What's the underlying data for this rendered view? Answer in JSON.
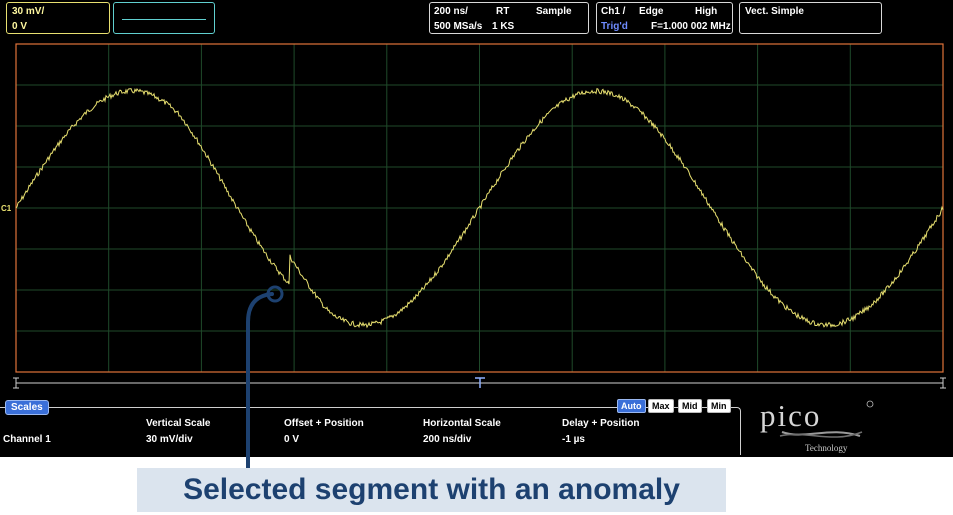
{
  "channel": {
    "scale": "30 mV/",
    "offset": "0 V",
    "color": "#e8e070"
  },
  "timebase": {
    "time_div": "200 ns/",
    "mode": "RT",
    "acq": "Sample",
    "sample_rate": "500 MSa/s",
    "record": "1 KS"
  },
  "trigger": {
    "source": "Ch1 /",
    "type": "Edge",
    "level": "High",
    "status": "Trig'd",
    "freq": "F=1.000 002 MHz"
  },
  "display": {
    "mode": "Vect. Simple"
  },
  "marker": {
    "ch1": "C1"
  },
  "scales": {
    "tag": "Scales",
    "headers": {
      "vertical": "Vertical Scale",
      "offset": "Offset + Position",
      "horizontal": "Horizontal Scale",
      "delay": "Delay + Position"
    },
    "row": {
      "name": "Channel 1",
      "vertical": "30 mV/div",
      "offset": "0 V",
      "horizontal": "200 ns/div",
      "delay": "-1 µs"
    },
    "buttons": {
      "auto": "Auto",
      "max": "Max",
      "mid": "Mid",
      "min": "Min"
    }
  },
  "logo": {
    "name": "pico",
    "sub": "Technology"
  },
  "callout": "Selected segment with an anomaly",
  "colors": {
    "grid_border": "#e0733a",
    "trace": "#e8e070",
    "scope_bg": "#000000",
    "callout": "#1d4170"
  }
}
